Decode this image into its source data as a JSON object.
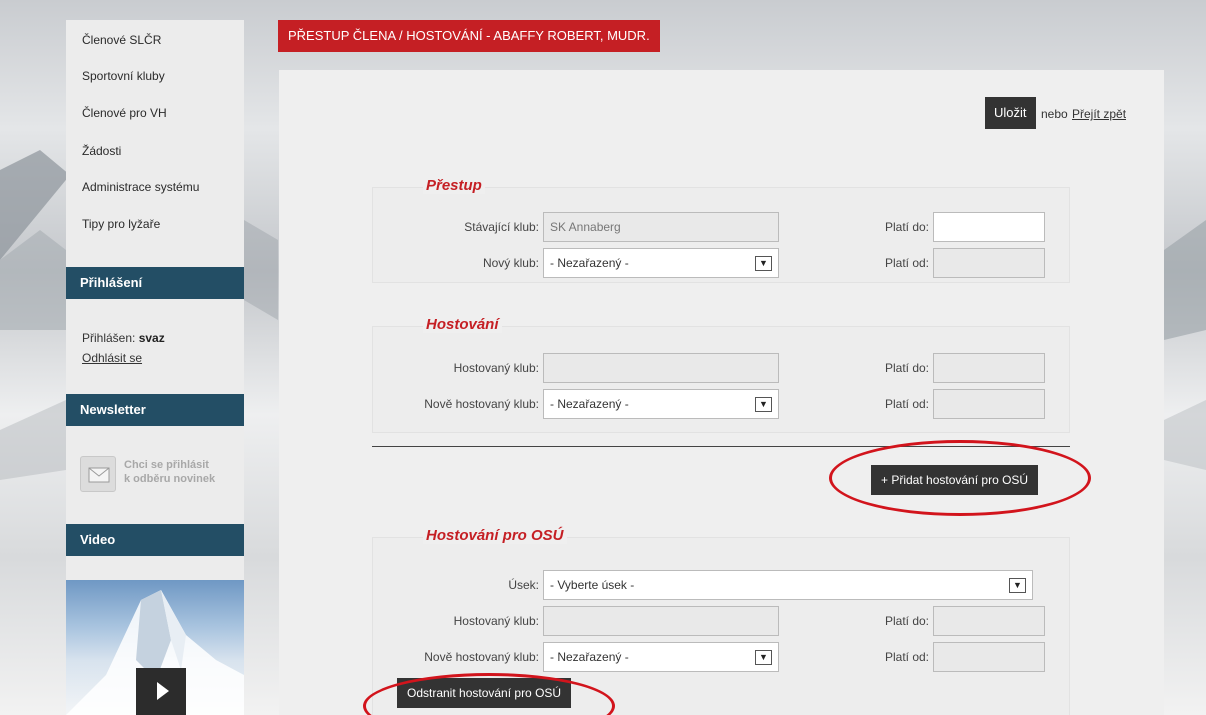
{
  "sidebar": {
    "nav": [
      {
        "label": "Členové SLČR"
      },
      {
        "label": "Sportovní kluby"
      },
      {
        "label": "Členové pro VH"
      },
      {
        "label": "Žádosti"
      },
      {
        "label": "Administrace systému"
      },
      {
        "label": "Tipy pro lyžaře"
      }
    ],
    "login_header": "Přihlášení",
    "logged_in_prefix": "Přihlášen: ",
    "username": "svaz",
    "logout": "Odhlásit se",
    "newsletter_header": "Newsletter",
    "newsletter_cta_line1": "Chci se přihlásit",
    "newsletter_cta_line2": "k odběru novinek",
    "video_header": "Video"
  },
  "page": {
    "title": "PŘESTUP ČLENA / HOSTOVÁNÍ - ABAFFY ROBERT, MUDR.",
    "save": "Uložit",
    "or": "nebo",
    "back": "Přejít zpět"
  },
  "prestup": {
    "legend": "Přestup",
    "current_club_label": "Stávající klub:",
    "current_club_value": "SK Annaberg",
    "valid_to_label": "Platí do:",
    "valid_to_value": "",
    "new_club_label": "Nový klub:",
    "new_club_value": "- Nezařazený -",
    "valid_from_label": "Platí od:",
    "valid_from_value": ""
  },
  "hostovani": {
    "legend": "Hostování",
    "host_club_label": "Hostovaný klub:",
    "host_club_value": "",
    "valid_to_label": "Platí do:",
    "valid_to_value": "",
    "new_host_club_label": "Nově hostovaný klub:",
    "new_host_club_value": "- Nezařazený -",
    "valid_from_label": "Platí od:",
    "valid_from_value": ""
  },
  "add_osu_button": "+ Přidat hostování pro OSÚ",
  "osu": {
    "legend": "Hostování pro OSÚ",
    "section_label": "Úsek:",
    "section_value": "- Vyberte úsek -",
    "host_club_label": "Hostovaný klub:",
    "host_club_value": "",
    "valid_to_label": "Platí do:",
    "valid_to_value": "",
    "new_host_club_label": "Nově hostovaný klub:",
    "new_host_club_value": "- Nezařazený -",
    "valid_from_label": "Platí od:",
    "valid_from_value": "",
    "remove_button": "Odstranit hostování pro OSÚ"
  },
  "colors": {
    "accent_red": "#c51f24",
    "sidebar_header": "#234e65",
    "button_dark": "#333333",
    "annotation_red": "#d2141c"
  }
}
